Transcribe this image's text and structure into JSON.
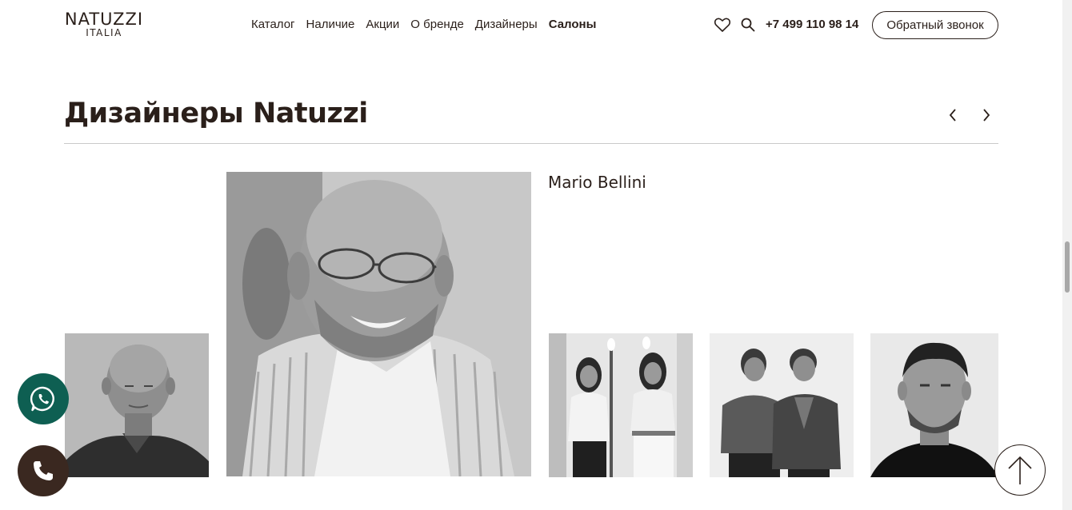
{
  "header": {
    "logo": {
      "main": "NATUZZI",
      "sub": "ITALIA"
    },
    "nav": [
      {
        "label": "Каталог",
        "active": false
      },
      {
        "label": "Наличие",
        "active": false
      },
      {
        "label": "Акции",
        "active": false
      },
      {
        "label": "О бренде",
        "active": false
      },
      {
        "label": "Дизайнеры",
        "active": false
      },
      {
        "label": "Салоны",
        "active": true
      }
    ],
    "icons": [
      "heart-icon",
      "search-icon"
    ],
    "phone": "+7 499 110 98 14",
    "callback_label": "Обратный звонок"
  },
  "section": {
    "title": "Дизайнеры Natuzzi",
    "prev_icon": "chevron-left-icon",
    "next_icon": "chevron-right-icon",
    "active_designer": "Mario Bellini"
  },
  "floating": {
    "whatsapp_icon": "whatsapp-icon",
    "call_icon": "phone-icon",
    "scroll_top_icon": "arrow-up-icon"
  },
  "colors": {
    "text": "#2a1f1a",
    "whatsapp": "#0e5f52",
    "call": "#3a2820",
    "divider": "#c9c9c9"
  }
}
